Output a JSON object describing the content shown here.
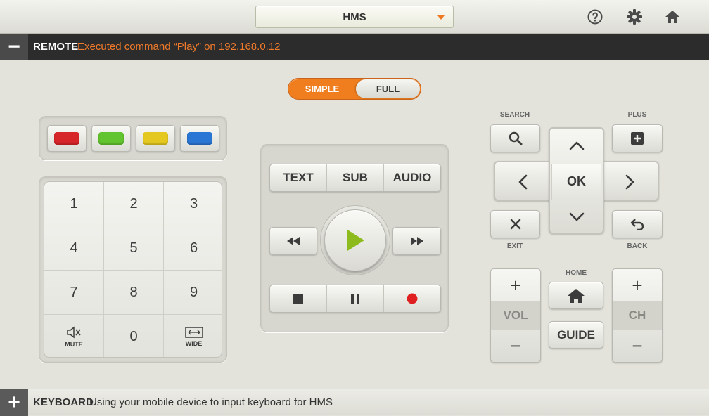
{
  "topbar": {
    "device_name": "HMS",
    "icons": [
      "help-icon",
      "gear-icon",
      "home-icon"
    ]
  },
  "remote_bar": {
    "toggle": "−",
    "title": "REMOTE",
    "message": "Executed command “Play” on 192.168.0.12"
  },
  "keyboard_bar": {
    "toggle": "+",
    "title": "KEYBOARD",
    "message": "Using your mobile device to input keyboard for HMS"
  },
  "mode_switch": {
    "simple": "SIMPLE",
    "full": "FULL",
    "selected": "SIMPLE"
  },
  "color_keys": [
    {
      "name": "red",
      "color": "#d7262a"
    },
    {
      "name": "green",
      "color": "#62c42e"
    },
    {
      "name": "yellow",
      "color": "#e4c820"
    },
    {
      "name": "blue",
      "color": "#2a76d4"
    }
  ],
  "numpad": {
    "keys": [
      "1",
      "2",
      "3",
      "4",
      "5",
      "6",
      "7",
      "8",
      "9"
    ],
    "mute_label": "MUTE",
    "zero": "0",
    "wide_label": "WIDE"
  },
  "media": {
    "text": "TEXT",
    "sub": "SUB",
    "audio": "AUDIO",
    "accent": "#8dba1c",
    "record_color": "#e02020"
  },
  "nav": {
    "search_label": "SEARCH",
    "plus_label": "PLUS",
    "exit_label": "EXIT",
    "back_label": "BACK",
    "ok": "OK",
    "home_label": "HOME",
    "guide": "GUIDE",
    "vol": "VOL",
    "ch": "CH"
  },
  "colors": {
    "accent": "#f07e1f",
    "bar_dark": "#2c2c2c",
    "message": "#f07a2a"
  }
}
